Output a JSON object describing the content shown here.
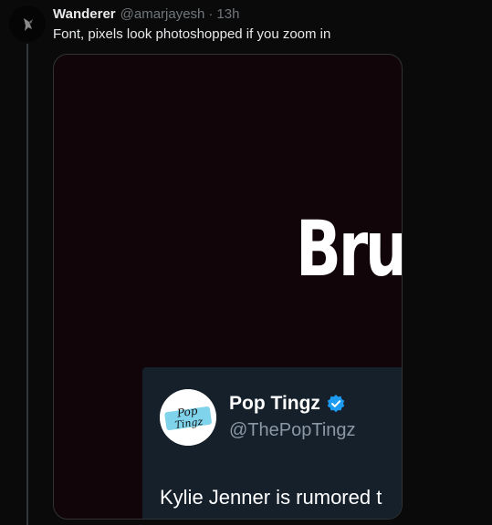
{
  "colors": {
    "background": "#0a0a0b",
    "media_background": "#120509",
    "card_background": "#15202b",
    "verified_blue": "#1d9bf0",
    "text_primary": "#e7e9ea",
    "text_secondary": "#71767b"
  },
  "tweet": {
    "avatar_icon": "bird-logo-icon",
    "display_name": "Wanderer",
    "handle": "@amarjayesh",
    "separator": "·",
    "timestamp": "13h",
    "text": "Font, pixels look photoshopped if you zoom in"
  },
  "media": {
    "big_word": "Bru",
    "embedded_post": {
      "avatar_text_top": "Pop",
      "avatar_text_bottom": "Tingz",
      "name": "Pop Tingz",
      "verified_icon": "verified-badge-icon",
      "handle": "@ThePopTingz",
      "text": "Kylie Jenner is rumored t"
    }
  }
}
